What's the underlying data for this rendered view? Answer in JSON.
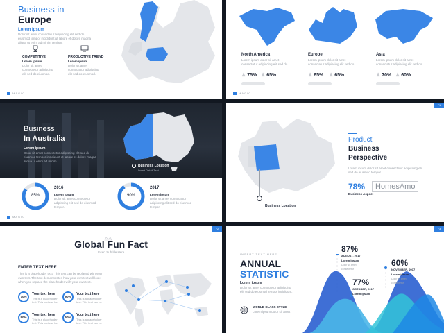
{
  "slide1": {
    "title_line1": "Business in",
    "title_line2": "Europe",
    "lorem_heading": "Lorem ipsum",
    "lorem_text": "Dolor sit amet consectetur adipiscing elit sed do eiusmod tempor incididunt ut labore et dolore magna aliqua ut enim ad minim veniam.",
    "feature1_title": "COMPETITIVE",
    "feature1_sub": "Lorem ipsum",
    "feature2_title": "PRODUCTIVE TREND",
    "feature2_sub": "Lorem ipsum",
    "feature_text": "Dolor sit amet consectetur adipiscing elit sed do eiusmod.",
    "logo": "MAGIC"
  },
  "slide2": {
    "regions": [
      {
        "name": "North America",
        "stat1": "75%",
        "stat2": "65%"
      },
      {
        "name": "Europe",
        "stat1": "65%",
        "stat2": "65%"
      },
      {
        "name": "Asia",
        "stat1": "70%",
        "stat2": "60%"
      }
    ],
    "lorem_text": "Lorem ipsum dolor sit amet consectetur adipiscing elit sed do.",
    "logo": "MAGIC"
  },
  "slide3": {
    "title_line1": "Business",
    "title_line2": "In Australia",
    "lorem_heading": "Lorem ipsum",
    "lorem_text": "Dolor sit amet consectetur adipiscing elit sed do eiusmod tempor incididunt ut labore et dolore magna aliqua ut enim ad minim.",
    "location_label": "Business Location",
    "location_sub": "Insert Detail Text",
    "year1": "2016",
    "year1_heading": "Lorem ipsum",
    "year1_text": "Dolor sit amet consectetur adipiscing elit sed do eiusmod tempor.",
    "pct1": "85%",
    "pct1_value": 85,
    "year2": "2017",
    "year2_heading": "Lorem ipsum",
    "year2_text": "Dolor sit amet consectetur adipiscing elit sed do eiusmod tempor.",
    "pct2": "90%",
    "pct2_value": 90,
    "logo": "MAGIC"
  },
  "slide4": {
    "tag": "71",
    "title_line1": "Product",
    "title_line2": "Business",
    "title_line3": "Perspective",
    "lorem_text": "Lorem ipsum dolor sit amet consectetur adipiscing elit sed do eiusmod tempor.",
    "stat": "78%",
    "stat_label": "Business Aspect",
    "location_label": "Business Location",
    "watermark": "HomesAmo"
  },
  "slide5": {
    "tag": "72",
    "title": "Global Fun Fact",
    "subtitle": "Insert Subtitle Here",
    "enter_text": "ENTER TEXT HERE",
    "body_text": "This is a placeholder text. This text can be replaced with your own text. The text demonstrates how your own text will look when you replace the placeholder with your own text.",
    "items": [
      {
        "pct": "70%",
        "label": "Your text here",
        "sub": "This is a placeholder text. This text can be"
      },
      {
        "pct": "90%",
        "label": "Your text here",
        "sub": "This is a placeholder text. This text can be"
      },
      {
        "pct": "80%",
        "label": "Your text here",
        "sub": "This is a placeholder text. This text can be"
      },
      {
        "pct": "50%",
        "label": "Your text here",
        "sub": "This is a placeholder text. This text can be"
      }
    ]
  },
  "slide6": {
    "tag": "73",
    "kicker": "INSERT TEXT HERE",
    "title_line1": "ANNUAL",
    "title_line2": "STATISTIC",
    "lorem_heading": "Lorem ipsum",
    "lorem_text": "Dolor sit amet consectetur adipiscing elit sed do eiusmod tempor incididunt.",
    "world_label": "WORLD CLASS STYLE",
    "world_text": "Lorem ipsum dolor sit amet",
    "stats": [
      {
        "pct": "87%",
        "month": "AUGUST, 2017",
        "heading": "Lorem ipsum"
      },
      {
        "pct": "60%",
        "month": "NOVEMBER, 2017",
        "heading": "Lorem ipsum"
      },
      {
        "pct": "77%",
        "month": "OCTOBER, 2017",
        "heading": "Lorem ipsum"
      }
    ],
    "stat_text": "Dolor sit amet consectetur"
  }
}
